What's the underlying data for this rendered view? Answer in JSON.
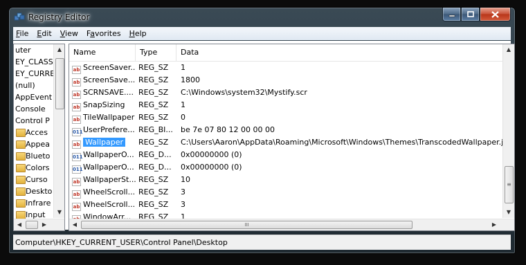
{
  "window": {
    "title": "Registry Editor"
  },
  "menu": [
    {
      "label": "File",
      "key": "F",
      "rest": "ile"
    },
    {
      "label": "Edit",
      "key": "E",
      "rest": "dit"
    },
    {
      "label": "View",
      "key": "V",
      "rest": "iew"
    },
    {
      "label": "Favorites",
      "key": "a",
      "pre": "F",
      "rest": "vorites"
    },
    {
      "label": "Help",
      "key": "H",
      "rest": "elp"
    }
  ],
  "tree": {
    "items": [
      {
        "label": "uter",
        "folder": false
      },
      {
        "label": "EY_CLASSI",
        "folder": false
      },
      {
        "label": "EY_CURRE",
        "folder": false
      },
      {
        "label": "(null)",
        "folder": false
      },
      {
        "label": "AppEvent",
        "folder": false
      },
      {
        "label": "Console",
        "folder": false
      },
      {
        "label": "Control P",
        "folder": false
      },
      {
        "label": "Acces",
        "folder": true
      },
      {
        "label": "Appea",
        "folder": true
      },
      {
        "label": "Blueto",
        "folder": true
      },
      {
        "label": "Colors",
        "folder": true
      },
      {
        "label": "Curso",
        "folder": true
      },
      {
        "label": "Deskto",
        "folder": true
      },
      {
        "label": "Infrare",
        "folder": true
      },
      {
        "label": "Input",
        "folder": true
      }
    ]
  },
  "list": {
    "columns": {
      "name": "Name",
      "type": "Type",
      "data": "Data"
    },
    "rows": [
      {
        "name": "ScreenSaver...",
        "type": "REG_SZ",
        "data": "1",
        "icon": "ab"
      },
      {
        "name": "ScreenSave...",
        "type": "REG_SZ",
        "data": "1800",
        "icon": "ab"
      },
      {
        "name": "SCRNSAVE....",
        "type": "REG_SZ",
        "data": "C:\\Windows\\system32\\Mystify.scr",
        "icon": "ab"
      },
      {
        "name": "SnapSizing",
        "type": "REG_SZ",
        "data": "1",
        "icon": "ab"
      },
      {
        "name": "TileWallpaper",
        "type": "REG_SZ",
        "data": "0",
        "icon": "ab"
      },
      {
        "name": "UserPrefere...",
        "type": "REG_BI...",
        "data": "be 7e 07 80 12 00 00 00",
        "icon": "bin"
      },
      {
        "name": "Wallpaper",
        "type": "REG_SZ",
        "data": "C:\\Users\\Aaron\\AppData\\Roaming\\Microsoft\\Windows\\Themes\\TranscodedWallpaper.jpg",
        "icon": "ab",
        "selected": true
      },
      {
        "name": "WallpaperO...",
        "type": "REG_D...",
        "data": "0x00000000 (0)",
        "icon": "bin"
      },
      {
        "name": "WallpaperO...",
        "type": "REG_D...",
        "data": "0x00000000 (0)",
        "icon": "bin"
      },
      {
        "name": "WallpaperSt...",
        "type": "REG_SZ",
        "data": "10",
        "icon": "ab"
      },
      {
        "name": "WheelScroll...",
        "type": "REG_SZ",
        "data": "3",
        "icon": "ab"
      },
      {
        "name": "WheelScroll...",
        "type": "REG_SZ",
        "data": "3",
        "icon": "ab"
      },
      {
        "name": "WindowArr...",
        "type": "REG_SZ",
        "data": "1",
        "icon": "ab"
      }
    ]
  },
  "statusbar": {
    "path": "Computer\\HKEY_CURRENT_USER\\Control Panel\\Desktop"
  },
  "scroll": {
    "hthumb": "III",
    "vthumb": "≡"
  }
}
